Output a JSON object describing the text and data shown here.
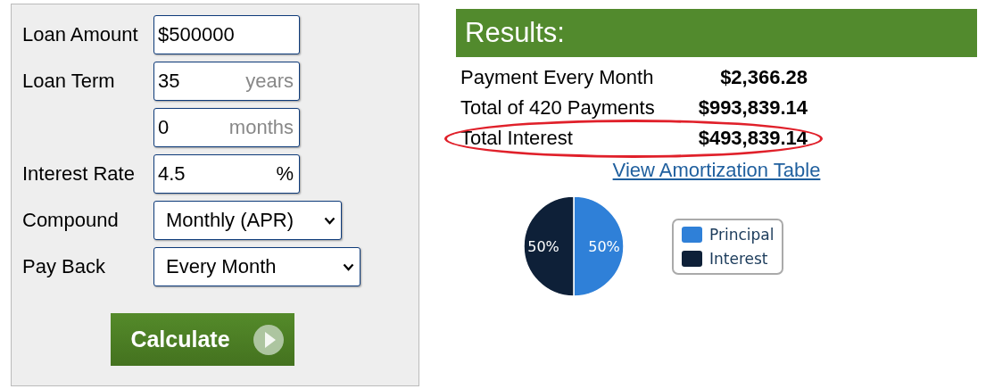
{
  "form": {
    "rows": [
      {
        "label": "Loan Amount",
        "control": {
          "kind": "input",
          "value": "$500000"
        }
      },
      {
        "label": "Loan Term",
        "control": {
          "kind": "input",
          "value": "35",
          "unit": "years",
          "unit_muted": true
        }
      },
      {
        "control": {
          "kind": "input",
          "value": "0",
          "unit": "months",
          "unit_muted": true
        }
      },
      {
        "label": "Interest Rate",
        "control": {
          "kind": "input",
          "value": "4.5",
          "unit": "%",
          "unit_muted": false
        }
      },
      {
        "label": "Compound",
        "control": {
          "kind": "select",
          "value": "Monthly (APR)"
        }
      },
      {
        "label": "Pay Back",
        "control": {
          "kind": "select",
          "value": "Every Month",
          "wide": true
        }
      }
    ],
    "button": "Calculate"
  },
  "results": {
    "title": "Results:",
    "rows": [
      {
        "label": "Payment Every Month",
        "value": "$2,366.28",
        "highlighted": false
      },
      {
        "label": "Total of 420 Payments",
        "value": "$993,839.14",
        "highlighted": false
      },
      {
        "label": "Total Interest",
        "value": "$493,839.14",
        "highlighted": true
      }
    ],
    "link": "View Amortization Table",
    "chart_data": {
      "type": "pie",
      "categories": [
        "Principal",
        "Interest"
      ],
      "values": [
        50,
        50
      ],
      "data_labels": true,
      "value_labels": [
        "50%",
        "50%"
      ]
    },
    "legend": [
      {
        "color": "#2f80d8"
      },
      {
        "color": "#0e2038"
      }
    ]
  }
}
